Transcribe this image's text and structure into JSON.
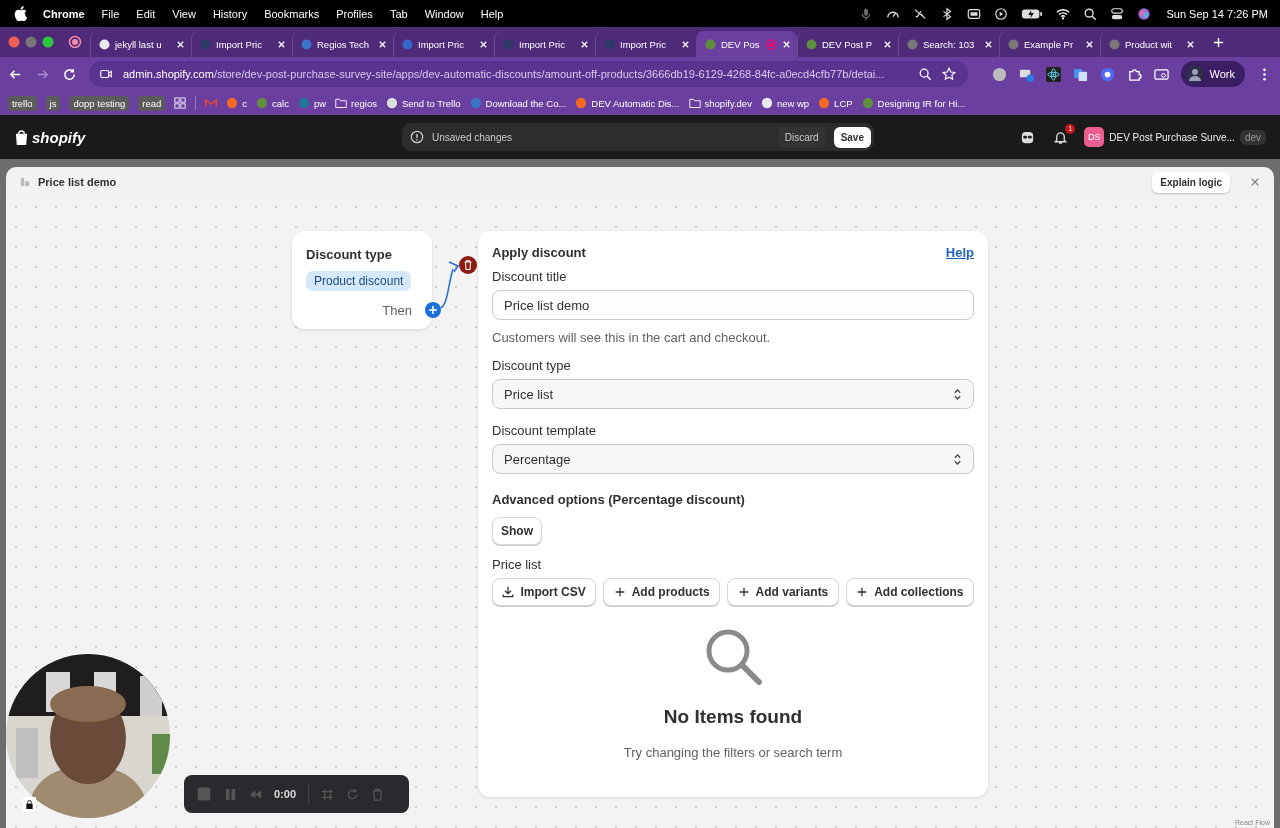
{
  "menu_bar": {
    "app": "Chrome",
    "items": [
      "File",
      "Edit",
      "View",
      "History",
      "Bookmarks",
      "Profiles",
      "Tab",
      "Window",
      "Help"
    ],
    "clock": "Sun Sep 14  7:26 PM"
  },
  "tabs": [
    {
      "title": "jekyll last u",
      "selected": false
    },
    {
      "title": "Import Pric",
      "selected": false
    },
    {
      "title": "Regios Tech",
      "selected": false
    },
    {
      "title": "Import Pric",
      "selected": false
    },
    {
      "title": "Import Pric",
      "selected": false
    },
    {
      "title": "Import Pric",
      "selected": false
    },
    {
      "title": "DEV Pos",
      "selected": true
    },
    {
      "title": "DEV Post P",
      "selected": false
    },
    {
      "title": "Search: 103",
      "selected": false
    },
    {
      "title": "Example Pr",
      "selected": false
    },
    {
      "title": "Product wit",
      "selected": false
    }
  ],
  "address_bar": {
    "domain": "admin.shopify.com",
    "path": "/store/dev-post-purchase-survey-site/apps/dev-automatic-discounts/amount-off-products/3666db19-6129-4268-84fc-a0ecd4cfb77b/detai...",
    "profile": "Work"
  },
  "bookmarks": [
    {
      "kind": "tag",
      "label": "trello"
    },
    {
      "kind": "tag",
      "label": "js"
    },
    {
      "kind": "tag",
      "label": "dopp testing"
    },
    {
      "kind": "tag",
      "label": "read"
    },
    {
      "kind": "link",
      "label": "c"
    },
    {
      "kind": "link",
      "label": "calc"
    },
    {
      "kind": "link",
      "label": "pw"
    },
    {
      "kind": "folder",
      "label": "regios"
    },
    {
      "kind": "link",
      "label": "Send to Trello"
    },
    {
      "kind": "link",
      "label": "Download the Co..."
    },
    {
      "kind": "link",
      "label": "DEV Automatic Dis..."
    },
    {
      "kind": "folder",
      "label": "shopify.dev"
    },
    {
      "kind": "link",
      "label": "new wp"
    },
    {
      "kind": "link",
      "label": "LCP"
    },
    {
      "kind": "link",
      "label": "Designing IR for Hi..."
    }
  ],
  "shopify_bar": {
    "logo": "shopify",
    "notice": "Unsaved changes",
    "discard": "Discard",
    "save": "Save",
    "notifications": "1",
    "avatar": "DS",
    "store": "DEV Post Purchase Surve...",
    "store_badge": "dev"
  },
  "panel": {
    "title": "Price list demo",
    "explain_button": "Explain logic"
  },
  "flow": {
    "trigger_node": {
      "title": "Discount type",
      "tag": "Product discount",
      "then_label": "Then"
    },
    "action_node": {
      "title": "Apply discount",
      "help_link": "Help",
      "fields": [
        {
          "kind": "text",
          "label": "Discount title",
          "value": "Price list demo",
          "hint": "Customers will see this in the cart and checkout."
        },
        {
          "kind": "select",
          "label": "Discount type",
          "value": "Price list"
        },
        {
          "kind": "select",
          "label": "Discount template",
          "value": "Percentage"
        }
      ],
      "advanced": {
        "title": "Advanced options (Percentage discount)",
        "button": "Show"
      },
      "price_list": {
        "label": "Price list",
        "actions": [
          {
            "kind": "import",
            "label": "Import CSV"
          },
          {
            "kind": "add",
            "label": "Add products"
          },
          {
            "kind": "add",
            "label": "Add variants"
          },
          {
            "kind": "add",
            "label": "Add collections"
          }
        ],
        "empty_title": "No Items found",
        "empty_message": "Try changing the filters or search term"
      }
    },
    "attribution": "React Flow"
  },
  "recorder": {
    "time": "0:00"
  }
}
